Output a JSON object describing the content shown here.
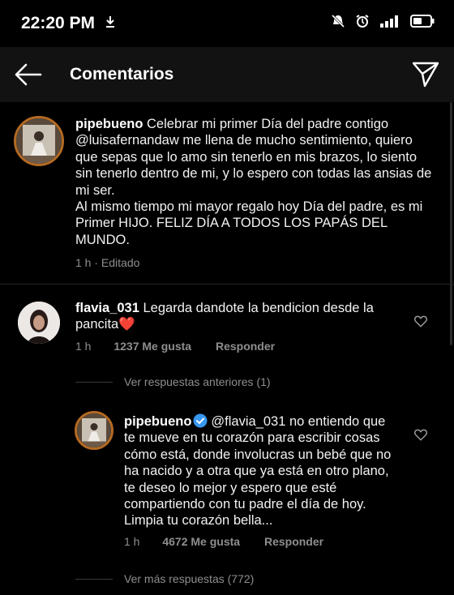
{
  "status_bar": {
    "time": "22:20 PM"
  },
  "header": {
    "title": "Comentarios"
  },
  "caption": {
    "username": "pipebueno",
    "text_1": " Celebrar mi primer Día del padre contigo ",
    "mention": "@luisafernandaw",
    "text_2": " me llena de mucho sentimiento, quiero que sepas que lo amo sin tenerlo en mis brazos, lo siento sin tenerlo dentro de mi, y lo espero con todas las ansias de mi ser.",
    "text_3": "Al mismo tiempo mi mayor regalo hoy Día del padre, es mi Primer HIJO. FELIZ DÍA A TODOS LOS PAPÁS DEL MUNDO.",
    "time": "1 h",
    "edited": " · Editado"
  },
  "comment": {
    "username": "flavia_031",
    "text": " Legarda dandote la bendicion desde la pancita",
    "emoji": "❤️",
    "time": "1 h",
    "likes": "1237 Me gusta",
    "reply": "Responder"
  },
  "view_previous": "Ver respuestas anteriores (1)",
  "reply": {
    "username": "pipebueno",
    "mention": "@flavia_031",
    "text": " no entiendo que te mueve en tu corazón para escribir cosas cómo está, donde involucras un bebé que no ha nacido y a otra que ya está en otro plano, te deseo lo mejor y espero que esté compartiendo con tu padre el día de hoy. Limpia tu corazón bella...",
    "time": "1 h",
    "likes": "4672 Me gusta",
    "reply": "Responder"
  },
  "view_more": "Ver más respuestas (772)"
}
